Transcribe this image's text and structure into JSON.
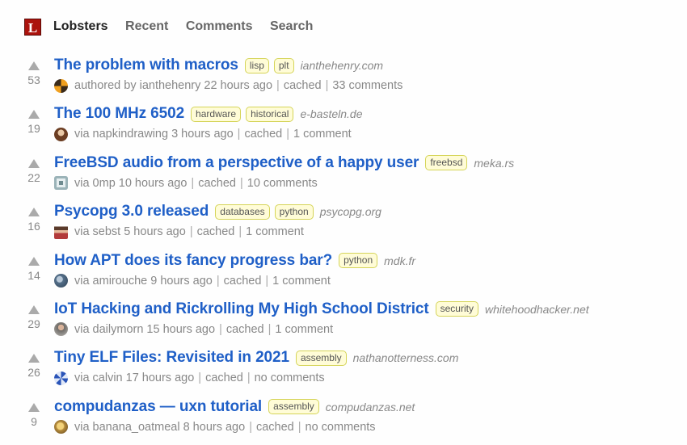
{
  "site": {
    "logo_letter": "L",
    "nav": [
      "Lobsters",
      "Recent",
      "Comments",
      "Search"
    ]
  },
  "colors": {
    "link": "#1f5fc7",
    "tag_bg": "#fffcd7",
    "tag_border": "#d5d458",
    "logo": "#ac130d"
  },
  "stories": [
    {
      "score": "53",
      "title": "The problem with macros",
      "tags": [
        "lisp",
        "plt"
      ],
      "domain": "ianthehenry.com",
      "prefix": "authored by",
      "user": "ianthehenry",
      "time": "22 hours ago",
      "cached": "cached",
      "comments": "33 comments",
      "avatar": "avatar-orange-geo"
    },
    {
      "score": "19",
      "title": "The 100 MHz 6502",
      "tags": [
        "hardware",
        "historical"
      ],
      "domain": "e-basteln.de",
      "prefix": "via",
      "user": "napkindrawing",
      "time": "3 hours ago",
      "cached": "cached",
      "comments": "1 comment",
      "avatar": "avatar-photo-brown"
    },
    {
      "score": "22",
      "title": "FreeBSD audio from a perspective of a happy user",
      "tags": [
        "freebsd"
      ],
      "domain": "meka.rs",
      "prefix": "via",
      "user": "0mp",
      "time": "10 hours ago",
      "cached": "cached",
      "comments": "10 comments",
      "avatar": "avatar-chip"
    },
    {
      "score": "16",
      "title": "Psycopg 3.0 released",
      "tags": [
        "databases",
        "python"
      ],
      "domain": "psycopg.org",
      "prefix": "via",
      "user": "sebst",
      "time": "5 hours ago",
      "cached": "cached",
      "comments": "1 comment",
      "avatar": "avatar-pixel-person"
    },
    {
      "score": "14",
      "title": "How APT does its fancy progress bar?",
      "tags": [
        "python"
      ],
      "domain": "mdk.fr",
      "prefix": "via",
      "user": "amirouche",
      "time": "9 hours ago",
      "cached": "cached",
      "comments": "1 comment",
      "avatar": "avatar-photo-blue"
    },
    {
      "score": "29",
      "title": "IoT Hacking and Rickrolling My High School District",
      "tags": [
        "security"
      ],
      "domain": "whitehoodhacker.net",
      "prefix": "via",
      "user": "dailymorn",
      "time": "15 hours ago",
      "cached": "cached",
      "comments": "1 comment",
      "avatar": "avatar-photo-person"
    },
    {
      "score": "26",
      "title": "Tiny ELF Files: Revisited in 2021",
      "tags": [
        "assembly"
      ],
      "domain": "nathanotterness.com",
      "prefix": "via",
      "user": "calvin",
      "time": "17 hours ago",
      "cached": "cached",
      "comments": "no comments",
      "avatar": "avatar-blue-geo"
    },
    {
      "score": "9",
      "title": "compudanzas — uxn tutorial",
      "tags": [
        "assembly"
      ],
      "domain": "compudanzas.net",
      "prefix": "via",
      "user": "banana_oatmeal",
      "time": "8 hours ago",
      "cached": "cached",
      "comments": "no comments",
      "avatar": "avatar-photo-yellow"
    }
  ]
}
